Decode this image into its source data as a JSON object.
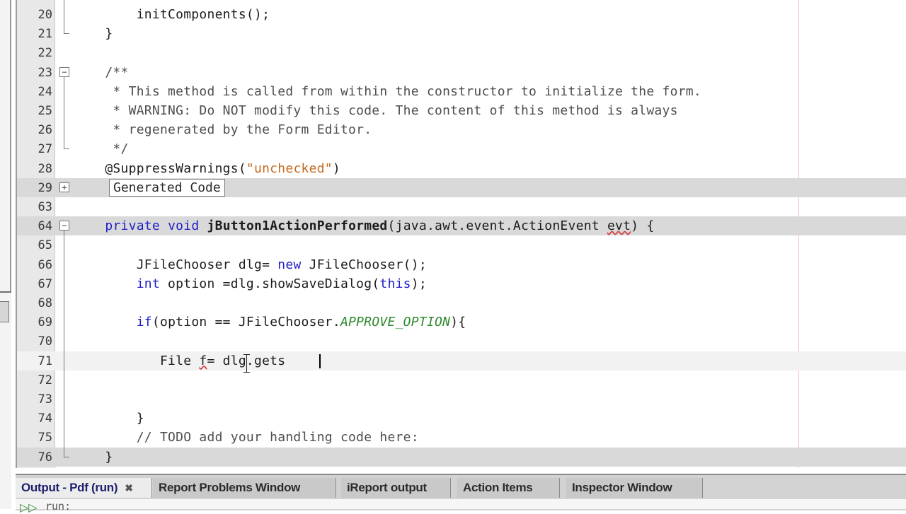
{
  "editor": {
    "lines": [
      {
        "n": "20",
        "segs": [
          {
            "t": "        initComponents();",
            "c": ""
          }
        ]
      },
      {
        "n": "21",
        "segs": [
          {
            "t": "    }",
            "c": ""
          }
        ]
      },
      {
        "n": "22",
        "segs": [
          {
            "t": "",
            "c": ""
          }
        ]
      },
      {
        "n": "23",
        "segs": [
          {
            "t": "    /**",
            "c": "cmt"
          }
        ]
      },
      {
        "n": "24",
        "segs": [
          {
            "t": "     * This method is called from within the constructor to initialize the form.",
            "c": "cmt"
          }
        ]
      },
      {
        "n": "25",
        "segs": [
          {
            "t": "     * WARNING: Do NOT modify this code. The content of this method is always",
            "c": "cmt"
          }
        ]
      },
      {
        "n": "26",
        "segs": [
          {
            "t": "     * regenerated by the Form Editor.",
            "c": "cmt"
          }
        ]
      },
      {
        "n": "27",
        "segs": [
          {
            "t": "     */",
            "c": "cmt"
          }
        ]
      },
      {
        "n": "28",
        "segs": [
          {
            "t": "    @SuppressWarnings(",
            "c": "ann"
          },
          {
            "t": "\"unchecked\"",
            "c": "str"
          },
          {
            "t": ")",
            "c": ""
          }
        ]
      },
      {
        "n": "29",
        "segs": []
      },
      {
        "n": "63",
        "segs": [
          {
            "t": "",
            "c": ""
          }
        ]
      },
      {
        "n": "64",
        "segs": [
          {
            "t": "    ",
            "c": ""
          },
          {
            "t": "private",
            "c": "kw"
          },
          {
            "t": " ",
            "c": ""
          },
          {
            "t": "void",
            "c": "kw"
          },
          {
            "t": " ",
            "c": ""
          },
          {
            "t": "jButton1ActionPerformed",
            "c": "bold"
          },
          {
            "t": "(java.awt.event.ActionEvent ",
            "c": ""
          },
          {
            "t": "evt",
            "c": "err"
          },
          {
            "t": ") {",
            "c": ""
          }
        ]
      },
      {
        "n": "65",
        "segs": [
          {
            "t": "",
            "c": ""
          }
        ]
      },
      {
        "n": "66",
        "segs": [
          {
            "t": "        JFileChooser dlg= ",
            "c": ""
          },
          {
            "t": "new",
            "c": "kw"
          },
          {
            "t": " JFileChooser();",
            "c": ""
          }
        ]
      },
      {
        "n": "67",
        "segs": [
          {
            "t": "        ",
            "c": ""
          },
          {
            "t": "int",
            "c": "kw"
          },
          {
            "t": " option =dlg.showSaveDialog(",
            "c": ""
          },
          {
            "t": "this",
            "c": "kw"
          },
          {
            "t": ");",
            "c": ""
          }
        ]
      },
      {
        "n": "68",
        "segs": [
          {
            "t": "",
            "c": ""
          }
        ]
      },
      {
        "n": "69",
        "segs": [
          {
            "t": "        ",
            "c": ""
          },
          {
            "t": "if",
            "c": "kw"
          },
          {
            "t": "(option == JFileChooser.",
            "c": ""
          },
          {
            "t": "APPROVE_OPTION",
            "c": "const"
          },
          {
            "t": "){",
            "c": ""
          }
        ]
      },
      {
        "n": "70",
        "segs": [
          {
            "t": "",
            "c": ""
          }
        ]
      },
      {
        "n": "71",
        "segs": [
          {
            "t": "           File ",
            "c": ""
          },
          {
            "t": "f",
            "c": "err"
          },
          {
            "t": "= dlg.gets",
            "c": ""
          }
        ]
      },
      {
        "n": "72",
        "segs": [
          {
            "t": "",
            "c": ""
          }
        ]
      },
      {
        "n": "73",
        "segs": [
          {
            "t": "",
            "c": ""
          }
        ]
      },
      {
        "n": "74",
        "segs": [
          {
            "t": "        }",
            "c": ""
          }
        ]
      },
      {
        "n": "75",
        "segs": [
          {
            "t": "        // TODO add your handling code here:",
            "c": "cmt"
          }
        ]
      },
      {
        "n": "76",
        "segs": [
          {
            "t": "    }",
            "c": ""
          }
        ]
      }
    ],
    "generated_code_label": "Generated Code"
  },
  "output_tabs": [
    {
      "label": "Output - Pdf (run)",
      "active": true,
      "closable": true
    },
    {
      "label": "Report Problems Window",
      "active": false
    },
    {
      "label": "iReport output",
      "active": false
    },
    {
      "label": "Action Items",
      "active": false
    },
    {
      "label": "Inspector Window",
      "active": false
    }
  ],
  "output": {
    "first_line": "run:"
  },
  "icons": {
    "fold_collapse": "minus-box-icon",
    "fold_expand": "plus-box-icon",
    "run": "run-arrow-icon",
    "close": "close-icon"
  }
}
